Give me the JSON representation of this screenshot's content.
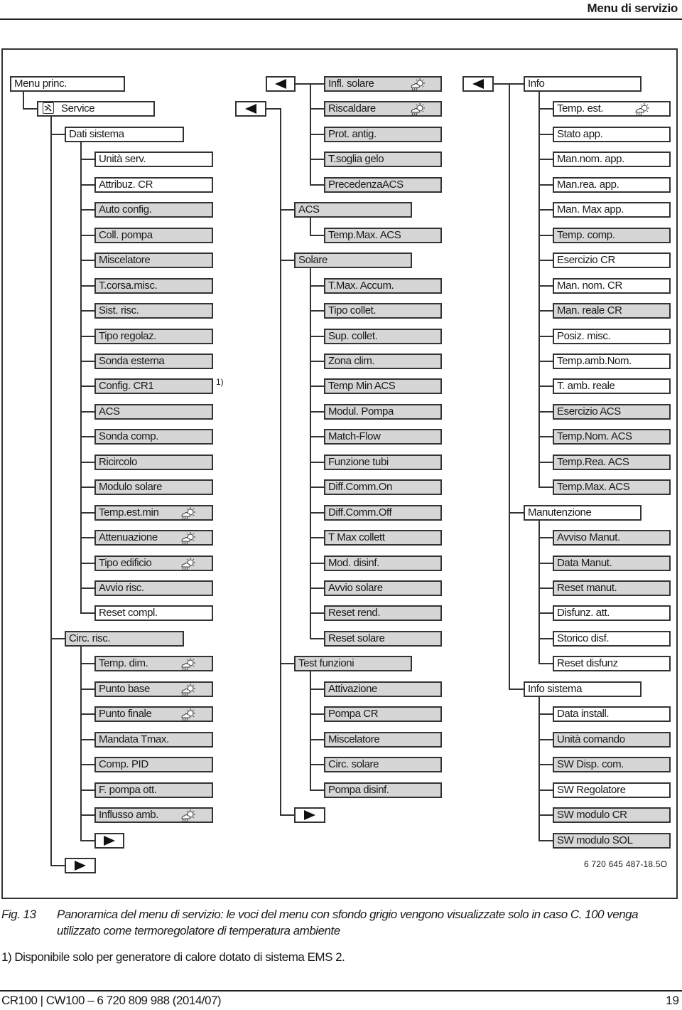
{
  "page": {
    "header_title": "Menu di servizio",
    "figure_code": "6 720 645 487-18.5O",
    "footnote_marker": "1)",
    "caption_label": "Fig. 13",
    "caption_text": "Panoramica del menu di servizio: le voci del menu con sfondo grigio vengono visualizzate solo in caso C. 100 venga utilizzato come termoregolatore di temperatura ambiente",
    "footnote": "1) Disponibile solo per generatore di calore dotato di sistema EMS 2.",
    "footer_left": "CR100 | CW100 – 6 720 809 988 (2014/07)",
    "footer_right": "19"
  },
  "legend": {
    "grey_background_meaning": "shown only when C. 100 is used as room temperature controller",
    "weather_icon_meaning": "weather-compensated setting"
  },
  "menu": {
    "root": "Menu princ.",
    "service": "Service",
    "column1": {
      "dati_sistema": {
        "label": "Dati sistema",
        "items": [
          {
            "label": "Unità serv.",
            "grey": false,
            "weather": false
          },
          {
            "label": "Attribuz. CR",
            "grey": false,
            "weather": false
          },
          {
            "label": "Auto config.",
            "grey": true,
            "weather": false
          },
          {
            "label": "Coll. pompa",
            "grey": true,
            "weather": false
          },
          {
            "label": "Miscelatore",
            "grey": true,
            "weather": false
          },
          {
            "label": "T.corsa.misc.",
            "grey": true,
            "weather": false
          },
          {
            "label": "Sist. risc.",
            "grey": true,
            "weather": false
          },
          {
            "label": "Tipo regolaz.",
            "grey": true,
            "weather": false
          },
          {
            "label": "Sonda esterna",
            "grey": true,
            "weather": false
          },
          {
            "label": "Config. CR1",
            "grey": true,
            "weather": false,
            "footnote": "1)"
          },
          {
            "label": "ACS",
            "grey": true,
            "weather": false
          },
          {
            "label": "Sonda comp.",
            "grey": true,
            "weather": false
          },
          {
            "label": "Ricircolo",
            "grey": true,
            "weather": false
          },
          {
            "label": "Modulo solare",
            "grey": true,
            "weather": false
          },
          {
            "label": "Temp.est.min",
            "grey": true,
            "weather": true
          },
          {
            "label": "Attenuazione",
            "grey": true,
            "weather": true
          },
          {
            "label": "Tipo edificio",
            "grey": true,
            "weather": true
          },
          {
            "label": "Avvio risc.",
            "grey": true,
            "weather": false
          },
          {
            "label": "Reset compl.",
            "grey": false,
            "weather": false
          }
        ]
      },
      "circ_risc": {
        "label": "Circ. risc.",
        "items": [
          {
            "label": "Temp. dim.",
            "grey": true,
            "weather": true
          },
          {
            "label": "Punto base",
            "grey": true,
            "weather": true
          },
          {
            "label": "Punto finale",
            "grey": true,
            "weather": true
          },
          {
            "label": "Mandata Tmax.",
            "grey": true,
            "weather": false
          },
          {
            "label": "Comp. PID",
            "grey": true,
            "weather": false
          },
          {
            "label": "F. pompa ott.",
            "grey": true,
            "weather": false
          },
          {
            "label": "Influsso amb.",
            "grey": true,
            "weather": true
          }
        ]
      }
    },
    "column2": {
      "continued_items": [
        {
          "label": "Infl. solare",
          "grey": true,
          "weather": true
        },
        {
          "label": "Riscaldare",
          "grey": true,
          "weather": true
        },
        {
          "label": "Prot. antig.",
          "grey": true,
          "weather": false
        },
        {
          "label": "T.soglia gelo",
          "grey": true,
          "weather": false
        },
        {
          "label": "PrecedenzaACS",
          "grey": true,
          "weather": false
        }
      ],
      "acs": {
        "label": "ACS",
        "items": [
          {
            "label": "Temp.Max. ACS",
            "grey": true,
            "weather": false
          }
        ]
      },
      "solare": {
        "label": "Solare",
        "items": [
          {
            "label": "T.Max. Accum.",
            "grey": true,
            "weather": false
          },
          {
            "label": "Tipo collet.",
            "grey": true,
            "weather": false
          },
          {
            "label": "Sup. collet.",
            "grey": true,
            "weather": false
          },
          {
            "label": "Zona clim.",
            "grey": true,
            "weather": false
          },
          {
            "label": "Temp Min ACS",
            "grey": true,
            "weather": false
          },
          {
            "label": "Modul. Pompa",
            "grey": true,
            "weather": false
          },
          {
            "label": "Match-Flow",
            "grey": true,
            "weather": false
          },
          {
            "label": "Funzione tubi",
            "grey": true,
            "weather": false
          },
          {
            "label": "Diff.Comm.On",
            "grey": true,
            "weather": false
          },
          {
            "label": "Diff.Comm.Off",
            "grey": true,
            "weather": false
          },
          {
            "label": "T Max collett",
            "grey": true,
            "weather": false
          },
          {
            "label": "Mod. disinf.",
            "grey": true,
            "weather": false
          },
          {
            "label": "Avvio solare",
            "grey": true,
            "weather": false
          },
          {
            "label": "Reset rend.",
            "grey": true,
            "weather": false
          },
          {
            "label": "Reset solare",
            "grey": true,
            "weather": false
          }
        ]
      },
      "test_funzioni": {
        "label": "Test funzioni",
        "items": [
          {
            "label": "Attivazione",
            "grey": true,
            "weather": false
          },
          {
            "label": "Pompa CR",
            "grey": true,
            "weather": false
          },
          {
            "label": "Miscelatore",
            "grey": true,
            "weather": false
          },
          {
            "label": "Circ. solare",
            "grey": true,
            "weather": false
          },
          {
            "label": "Pompa disinf.",
            "grey": true,
            "weather": false
          }
        ]
      }
    },
    "column3": {
      "info": {
        "label": "Info",
        "items": [
          {
            "label": "Temp. est.",
            "grey": false,
            "weather": true
          },
          {
            "label": "Stato app.",
            "grey": false,
            "weather": false
          },
          {
            "label": "Man.nom. app.",
            "grey": false,
            "weather": false
          },
          {
            "label": "Man.rea. app.",
            "grey": false,
            "weather": false
          },
          {
            "label": "Man. Max app.",
            "grey": false,
            "weather": false
          },
          {
            "label": "Temp. comp.",
            "grey": true,
            "weather": false
          },
          {
            "label": "Esercizio CR",
            "grey": false,
            "weather": false
          },
          {
            "label": "Man. nom. CR",
            "grey": false,
            "weather": false
          },
          {
            "label": "Man. reale CR",
            "grey": true,
            "weather": false
          },
          {
            "label": "Posiz. misc.",
            "grey": false,
            "weather": false
          },
          {
            "label": "Temp.amb.Nom.",
            "grey": false,
            "weather": false
          },
          {
            "label": "T. amb. reale",
            "grey": false,
            "weather": false
          },
          {
            "label": "Esercizio ACS",
            "grey": true,
            "weather": false
          },
          {
            "label": "Temp.Nom. ACS",
            "grey": true,
            "weather": false
          },
          {
            "label": "Temp.Rea. ACS",
            "grey": true,
            "weather": false
          },
          {
            "label": "Temp.Max. ACS",
            "grey": true,
            "weather": false
          }
        ]
      },
      "manutenzione": {
        "label": "Manutenzione",
        "items": [
          {
            "label": "Avviso Manut.",
            "grey": true,
            "weather": false
          },
          {
            "label": "Data Manut.",
            "grey": true,
            "weather": false
          },
          {
            "label": "Reset manut.",
            "grey": true,
            "weather": false
          },
          {
            "label": "Disfunz. att.",
            "grey": false,
            "weather": false
          },
          {
            "label": "Storico disf.",
            "grey": false,
            "weather": false
          },
          {
            "label": "Reset disfunz",
            "grey": false,
            "weather": false
          }
        ]
      },
      "info_sistema": {
        "label": "Info sistema",
        "items": [
          {
            "label": "Data install.",
            "grey": false,
            "weather": false
          },
          {
            "label": "Unità comando",
            "grey": true,
            "weather": false
          },
          {
            "label": "SW Disp. com.",
            "grey": true,
            "weather": false
          },
          {
            "label": "SW Regolatore",
            "grey": false,
            "weather": false
          },
          {
            "label": "SW modulo CR",
            "grey": true,
            "weather": false
          },
          {
            "label": "SW modulo SOL",
            "grey": true,
            "weather": false
          }
        ]
      }
    }
  }
}
